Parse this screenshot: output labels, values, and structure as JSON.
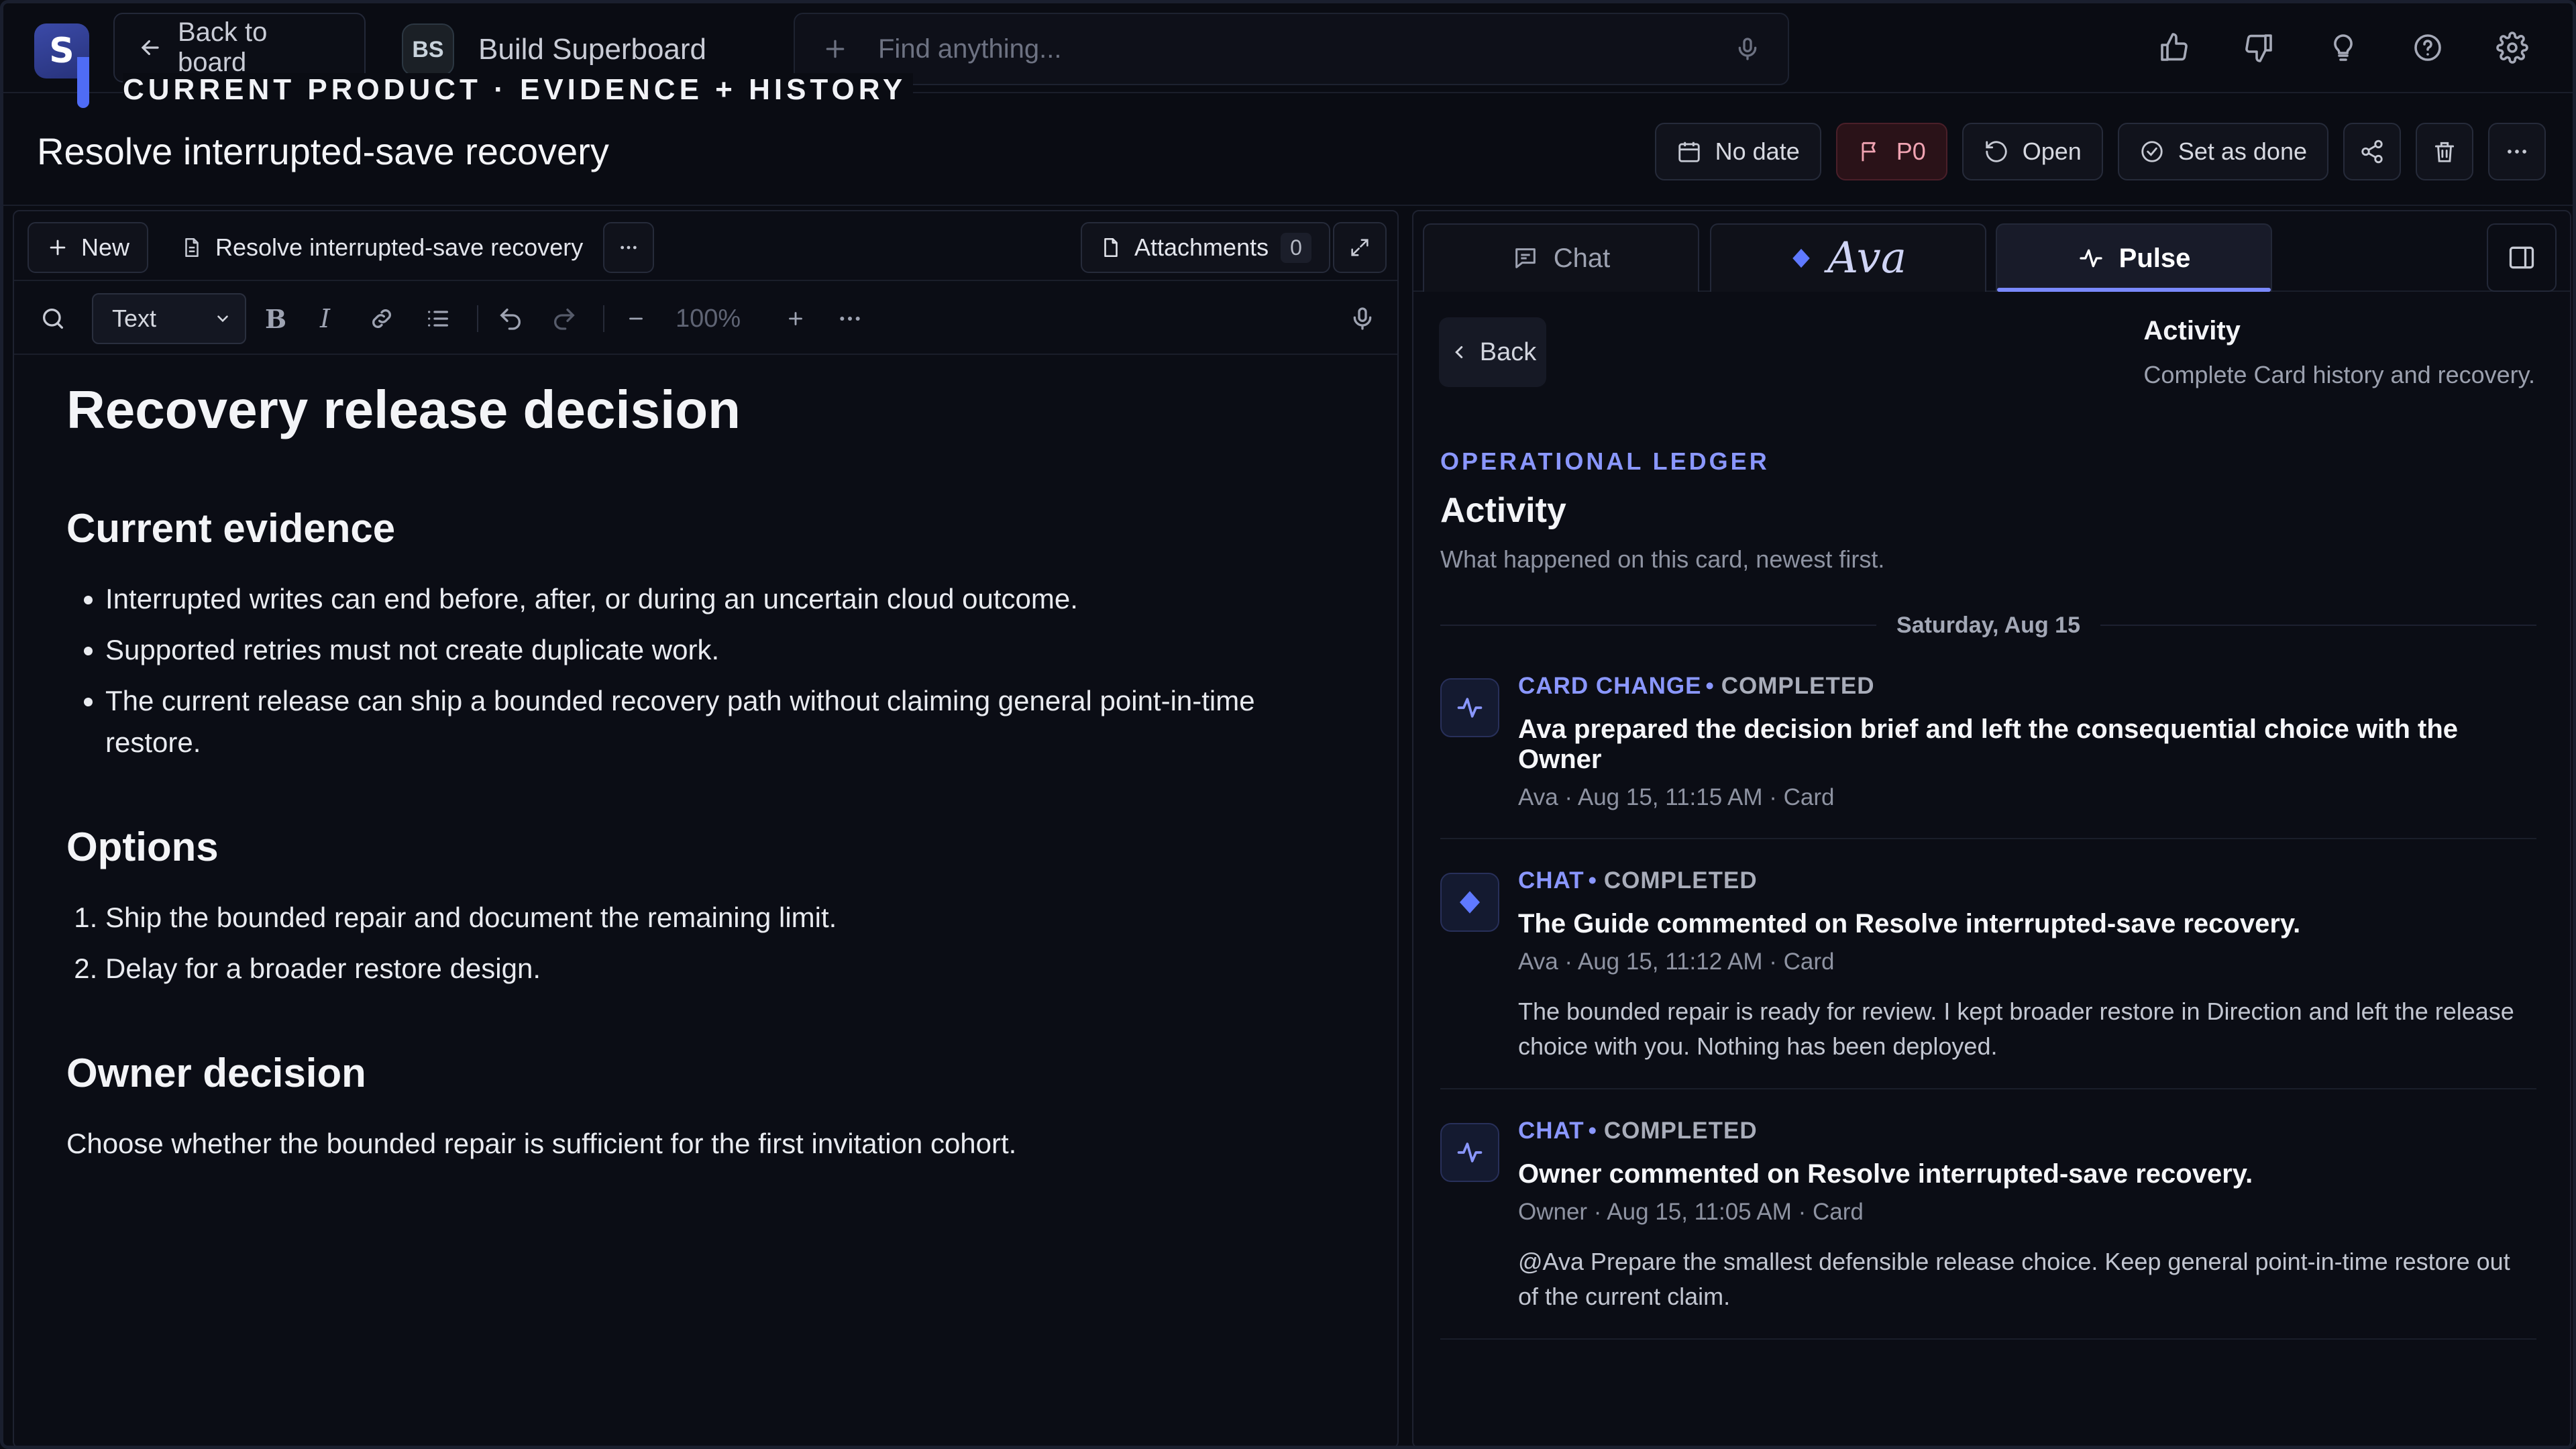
{
  "topbar": {
    "logo_letter": "S",
    "back_label": "Back to board",
    "project_initials": "BS",
    "project_name": "Build Superboard",
    "search_placeholder": "Find anything...",
    "overline": "CURRENT PRODUCT · EVIDENCE + HISTORY",
    "icons": [
      "thumbs-up-icon",
      "thumbs-down-icon",
      "lightbulb-icon",
      "help-icon",
      "settings-icon"
    ]
  },
  "card": {
    "title": "Resolve interrupted-save recovery",
    "actions": {
      "date": "No date",
      "priority": "P0",
      "status": "Open",
      "done": "Set as done"
    }
  },
  "editor": {
    "new_label": "New",
    "doc_name": "Resolve interrupted-save recovery",
    "attachments_label": "Attachments",
    "attachments_count": "0",
    "style_select": "Text",
    "zoom": "100%",
    "document": {
      "title": "Recovery release decision",
      "sections": [
        {
          "heading": "Current evidence",
          "items": [
            "Interrupted writes can end before, after, or during an uncertain cloud outcome.",
            "Supported retries must not create duplicate work.",
            "The current release can ship a bounded recovery path without claiming general point-in-time restore."
          ]
        },
        {
          "heading": "Options",
          "items": [
            "Ship the bounded repair and document the remaining limit.",
            "Delay for a broader restore design."
          ]
        },
        {
          "heading": "Owner decision",
          "text": "Choose whether the bounded repair is sufficient for the first invitation cohort."
        }
      ]
    }
  },
  "panel": {
    "tabs": [
      "Chat",
      "Ava",
      "Pulse"
    ],
    "active_tab": "Pulse",
    "back_label": "Back",
    "header_title": "Activity",
    "header_subtitle": "Complete Card history and recovery.",
    "eyebrow": "OPERATIONAL LEDGER",
    "title": "Activity",
    "description": "What happened on this card, newest first.",
    "day": "Saturday, Aug 15",
    "events": [
      {
        "kind": "CARD CHANGE",
        "status": "COMPLETED",
        "icon": "pulse-icon",
        "title": "Ava prepared the decision brief and left the consequential choice with the Owner",
        "meta": "Ava · Aug 15, 11:15 AM · Card",
        "body": ""
      },
      {
        "kind": "CHAT",
        "status": "COMPLETED",
        "icon": "diamond-icon",
        "title": "The Guide commented on Resolve interrupted-save recovery.",
        "meta": "Ava · Aug 15, 11:12 AM · Card",
        "body": "The bounded repair is ready for review. I kept broader restore in Direction and left the release choice with you. Nothing has been deployed."
      },
      {
        "kind": "CHAT",
        "status": "COMPLETED",
        "icon": "pulse-icon",
        "title": "Owner commented on Resolve interrupted-save recovery.",
        "meta": "Owner · Aug 15, 11:05 AM · Card",
        "body": "@Ava Prepare the smallest defensible release choice. Keep general point-in-time restore out of the current claim."
      }
    ]
  },
  "colors": {
    "accent": "#8a97ff",
    "priority": "#f0a3b2",
    "background": "#0a0c13"
  }
}
